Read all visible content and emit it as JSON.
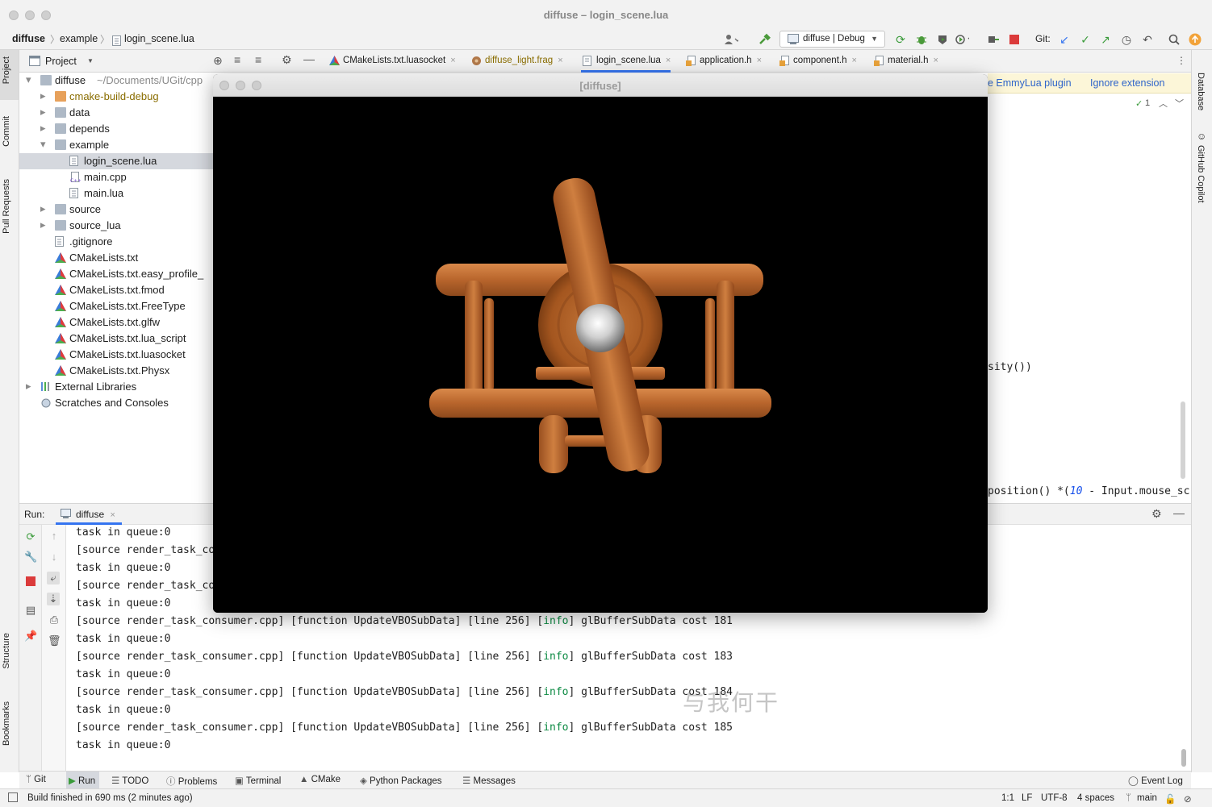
{
  "window": {
    "title": "diffuse – login_scene.lua"
  },
  "breadcrumbs": [
    "diffuse",
    "example",
    "login_scene.lua"
  ],
  "toolbar": {
    "run_config": "diffuse | Debug",
    "git_label": "Git:"
  },
  "left_strip": {
    "tabs": [
      "Project",
      "Commit",
      "Pull Requests",
      "Structure",
      "Bookmarks"
    ]
  },
  "right_strip": {
    "tabs": [
      "Database",
      "GitHub Copilot"
    ]
  },
  "project_panel": {
    "title": "Project",
    "tree": [
      {
        "label": "diffuse",
        "hint": "~/Documents/UGit/cpp",
        "icon": "folder-icon",
        "expanded": true
      },
      {
        "label": "cmake-build-debug",
        "icon": "folder-orange-icon",
        "expanded": false
      },
      {
        "label": "data",
        "icon": "folder-icon",
        "expanded": false
      },
      {
        "label": "depends",
        "icon": "folder-icon",
        "expanded": false
      },
      {
        "label": "example",
        "icon": "folder-icon",
        "expanded": true
      },
      {
        "label": "login_scene.lua",
        "icon": "lua-file-icon",
        "selected": true
      },
      {
        "label": "main.cpp",
        "icon": "cpp-file-icon"
      },
      {
        "label": "main.lua",
        "icon": "lua-file-icon"
      },
      {
        "label": "source",
        "icon": "folder-icon",
        "expanded": false
      },
      {
        "label": "source_lua",
        "icon": "folder-icon",
        "expanded": false
      },
      {
        "label": ".gitignore",
        "icon": "gitignore-file-icon"
      },
      {
        "label": "CMakeLists.txt",
        "icon": "cmake-file-icon"
      },
      {
        "label": "CMakeLists.txt.easy_profile_",
        "icon": "cmake-file-icon"
      },
      {
        "label": "CMakeLists.txt.fmod",
        "icon": "cmake-file-icon"
      },
      {
        "label": "CMakeLists.txt.FreeType",
        "icon": "cmake-file-icon"
      },
      {
        "label": "CMakeLists.txt.glfw",
        "icon": "cmake-file-icon"
      },
      {
        "label": "CMakeLists.txt.lua_script",
        "icon": "cmake-file-icon"
      },
      {
        "label": "CMakeLists.txt.luasocket",
        "icon": "cmake-file-icon"
      },
      {
        "label": "CMakeLists.txt.Physx",
        "icon": "cmake-file-icon"
      },
      {
        "label": "External Libraries",
        "icon": "library-icon",
        "expanded": false
      },
      {
        "label": "Scratches and Consoles",
        "icon": "scratches-icon"
      }
    ]
  },
  "editor_tabs": [
    {
      "label": "CMakeLists.txt.luasocket",
      "icon": "cmake-file-icon"
    },
    {
      "label": "diffuse_light.frag",
      "icon": "shader-file-icon"
    },
    {
      "label": "login_scene.lua",
      "icon": "lua-file-icon",
      "active": true
    },
    {
      "label": "application.h",
      "icon": "header-file-icon"
    },
    {
      "label": "component.h",
      "icon": "header-file-icon"
    },
    {
      "label": "material.h",
      "icon": "header-file-icon"
    }
  ],
  "editor": {
    "banner_link1": "e EmmyLua plugin",
    "banner_link2": "Ignore extension",
    "inspection_count": "1",
    "code_fragment1": "sity())",
    "code_fragment2_a": "position() *(",
    "code_fragment2_num": "10",
    "code_fragment2_b": " - Input.mouse_sc"
  },
  "game_window": {
    "title": "[diffuse]"
  },
  "run_panel": {
    "label": "Run:",
    "tab": "diffuse",
    "lines_top": [
      "task in queue:0",
      "[source render_task_co",
      "task in queue:0",
      "[source render_task_co",
      "task in queue:0"
    ],
    "log_prefix": "[source render_task_consumer.cpp] [function UpdateVBOSubData] [line 256] [",
    "log_info": "info",
    "log_suffix": "] glBufferSubData cost ",
    "log_costs": [
      "181",
      "183",
      "184",
      "185"
    ],
    "queue_line": "task in queue:0"
  },
  "watermark": "与我何干",
  "bottom_tabs": [
    "Git",
    "Run",
    "TODO",
    "Problems",
    "Terminal",
    "CMake",
    "Python Packages",
    "Messages"
  ],
  "event_log": "Event Log",
  "status": {
    "message": "Build finished in 690 ms (2 minutes ago)",
    "position": "1:1",
    "line_sep": "LF",
    "encoding": "UTF-8",
    "indent": "4 spaces",
    "branch": "main"
  },
  "colors": {
    "accent": "#3574f0",
    "info_green": "#0c8a43",
    "banner_bg": "#fcf6d8",
    "wood": "#b5652a"
  }
}
